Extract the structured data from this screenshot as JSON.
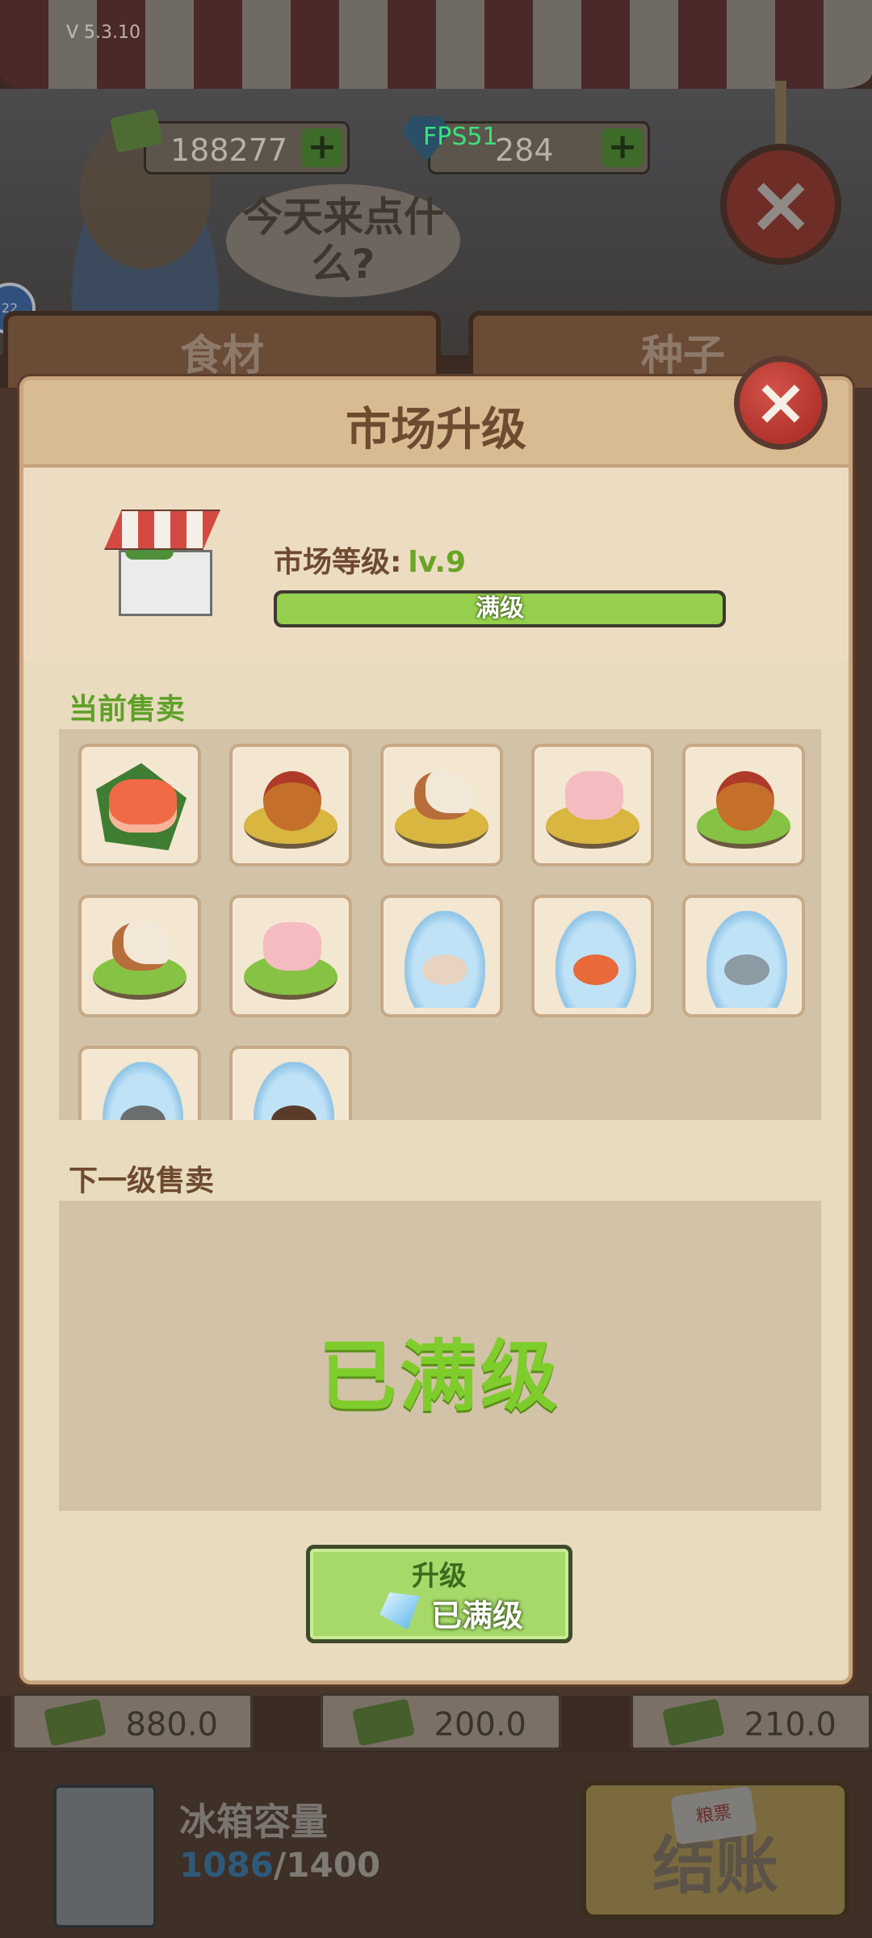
{
  "version": "V 5.3.10",
  "top": {
    "cash": "188277",
    "gems": "284",
    "fps": "FPS51",
    "plus": "+"
  },
  "speech": "今天来点什么?",
  "tabs": [
    "食材",
    "种子"
  ],
  "side_chip": "22",
  "dialog": {
    "title": "市场升级",
    "close": "×",
    "level_label": "市场等级:",
    "level_value": "lv.9",
    "progress_text": "满级",
    "progress_fraction": 1.0,
    "current_section": "当前售卖",
    "next_section": "下一级售卖",
    "maxed_text": "已满级",
    "upgrade_label": "升级",
    "upgrade_cost": "已满级",
    "items": [
      {
        "name": "salmon-sashimi",
        "icon": "salmon-icon"
      },
      {
        "name": "chicken-hay",
        "icon": "chicken-icon"
      },
      {
        "name": "cow-hay",
        "icon": "cow-icon"
      },
      {
        "name": "pig-hay",
        "icon": "pig-icon"
      },
      {
        "name": "chicken-grass",
        "icon": "chicken-icon"
      },
      {
        "name": "cow-grass",
        "icon": "cow-icon"
      },
      {
        "name": "pig-grass",
        "icon": "pig-icon"
      },
      {
        "name": "clam-bag",
        "icon": "clam-icon"
      },
      {
        "name": "shrimp-bag",
        "icon": "shrimp-icon"
      },
      {
        "name": "fish-bag",
        "icon": "fish-icon"
      },
      {
        "name": "fish2-bag",
        "icon": "fish-icon"
      },
      {
        "name": "crab-bag",
        "icon": "crab-icon"
      }
    ]
  },
  "prices": [
    "880.0",
    "200.0",
    "210.0"
  ],
  "footer": {
    "fridge_title": "冰箱容量",
    "fridge_current": "1086",
    "fridge_sep": "/1400",
    "ticket": "粮票",
    "checkout": "结账"
  },
  "colors": {
    "accent_green": "#7fcd2c",
    "title_brown": "#6e4a30",
    "close_red": "#c4423a"
  }
}
